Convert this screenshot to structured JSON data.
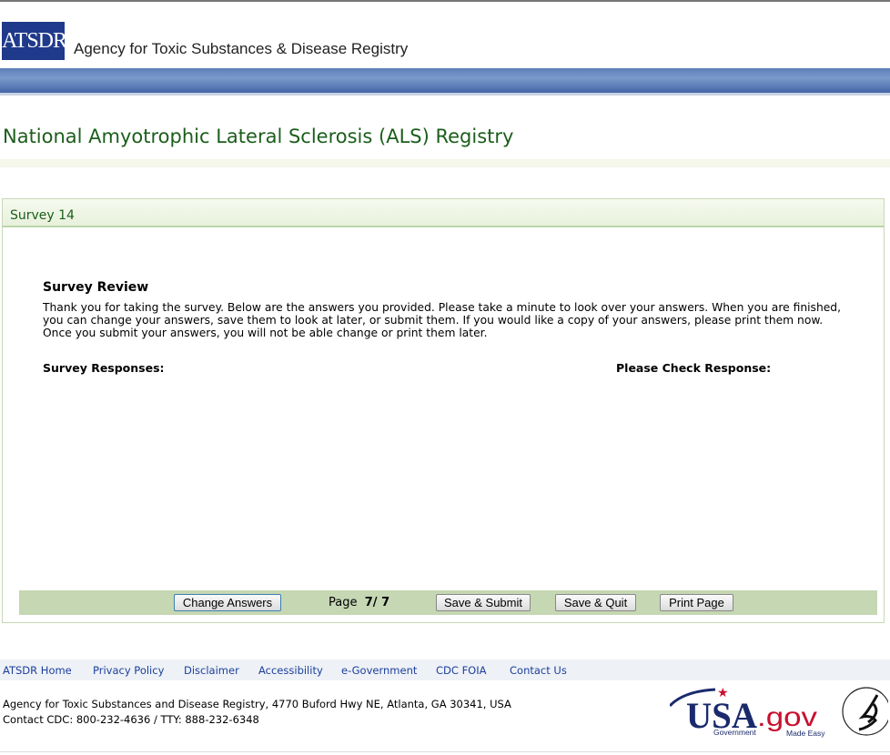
{
  "header": {
    "logo_text": "ATSDR",
    "agency": "Agency for Toxic Substances & Disease Registry"
  },
  "page_title": "National Amyotrophic Lateral Sclerosis (ALS) Registry",
  "panel": {
    "title": "Survey 14",
    "review_heading": "Survey Review",
    "review_text": "Thank you for taking the survey. Below are the answers you provided. Please take a minute to look over your answers. When you are finished, you can change your answers, save them to look at later, or submit them. If you would like a copy of your answers, please print them now. Once you submit your answers, you will not be able change or print them later.",
    "col_responses": "Survey Responses:",
    "col_check": "Please Check Response:",
    "buttons": {
      "change": "Change Answers",
      "submit": "Save & Submit",
      "quit": "Save & Quit",
      "print": "Print Page"
    },
    "page_label": "Page",
    "page_value": "7/ 7"
  },
  "footer": {
    "links": [
      "ATSDR Home",
      "Privacy Policy",
      "Disclaimer",
      "Accessibility",
      "e-Government",
      "CDC FOIA",
      "Contact Us"
    ],
    "address": "Agency for Toxic Substances and Disease Registry, 4770 Buford Hwy NE, Atlanta, GA 30341, USA",
    "contact": "Contact CDC: 800-232-4636 / TTY: 888-232-6348",
    "usagov_logo": "USA.gov Government Made Easy",
    "hhs_logo": "Department of Health & Human Services USA"
  },
  "colors": {
    "title_green": "#1b5e1b",
    "link_blue": "#1b3f9b",
    "bar_blue": "#5d7fb8",
    "button_bar": "#c5d7b3"
  }
}
